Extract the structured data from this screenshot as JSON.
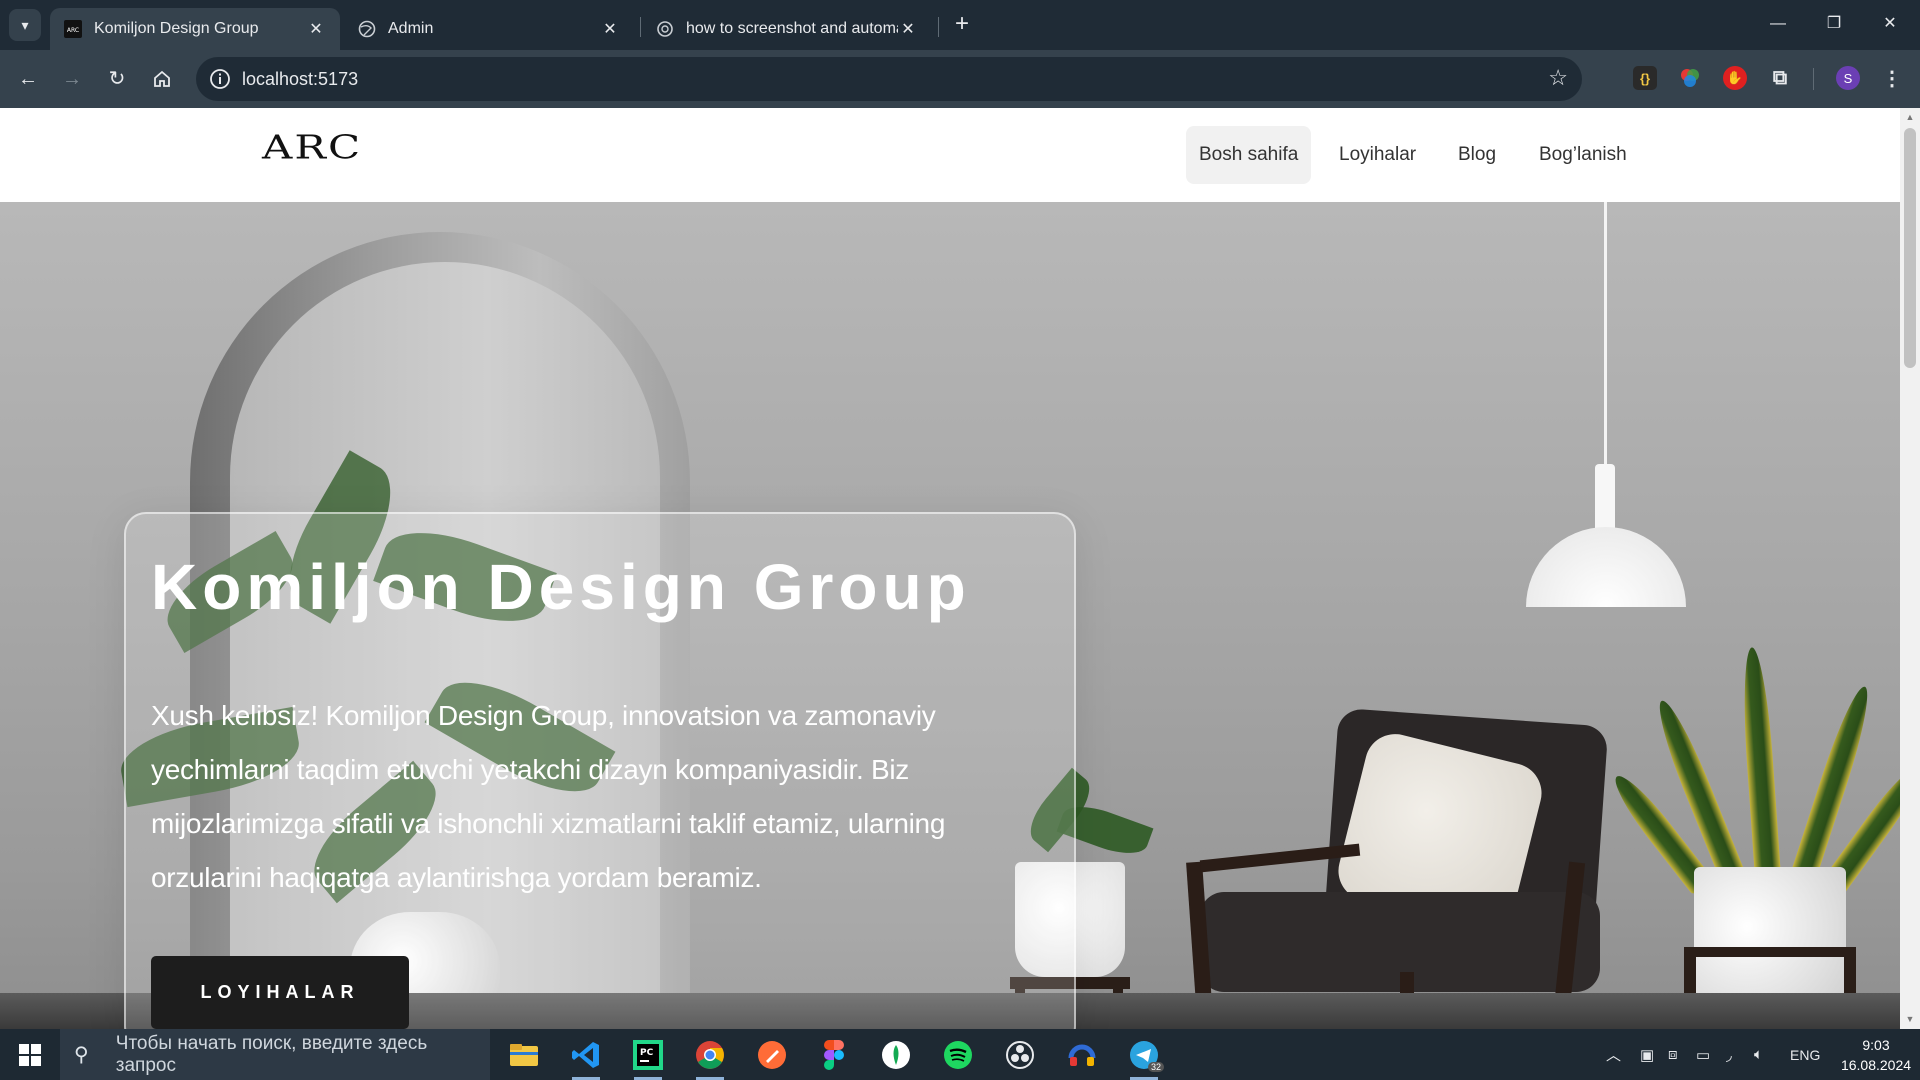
{
  "browser": {
    "tabs": [
      {
        "title": "Komiljon Design Group",
        "active": true,
        "favicon": "arc-logo-icon"
      },
      {
        "title": "Admin",
        "active": false,
        "favicon": "globe-icon"
      },
      {
        "title": "how to screenshot and automa",
        "active": false,
        "favicon": "openai-icon"
      }
    ],
    "url": "localhost:5173",
    "profile_initial": "S"
  },
  "site": {
    "logo": "ARC",
    "nav": [
      {
        "label": "Bosh sahifa",
        "active": true
      },
      {
        "label": "Loyihalar",
        "active": false
      },
      {
        "label": "Blog",
        "active": false
      },
      {
        "label": "Bog’lanish",
        "active": false
      }
    ],
    "hero": {
      "title": "Komiljon Design Group",
      "text": "Xush kelibsiz! Komiljon Design Group, innovatsion va zamonaviy yechimlarni taqdim etuvchi yetakchi dizayn kompaniyasidir. Biz mijozlarimizga sifatli va ishonchli xizmatlarni taklif etamiz, ularning orzularini haqiqatga aylantirishga yordam beramiz.",
      "button": "LOYIHALAR"
    }
  },
  "taskbar": {
    "search_placeholder": "Чтобы начать поиск, введите здесь запрос",
    "language": "ENG",
    "time": "9:03",
    "date": "16.08.2024",
    "telegram_badge": "32"
  },
  "colors": {
    "chrome_dark": "#1f2b36",
    "chrome_toolbar": "#35424d",
    "button_dark": "#1d1d1d",
    "profile": "#6b3fb4"
  }
}
